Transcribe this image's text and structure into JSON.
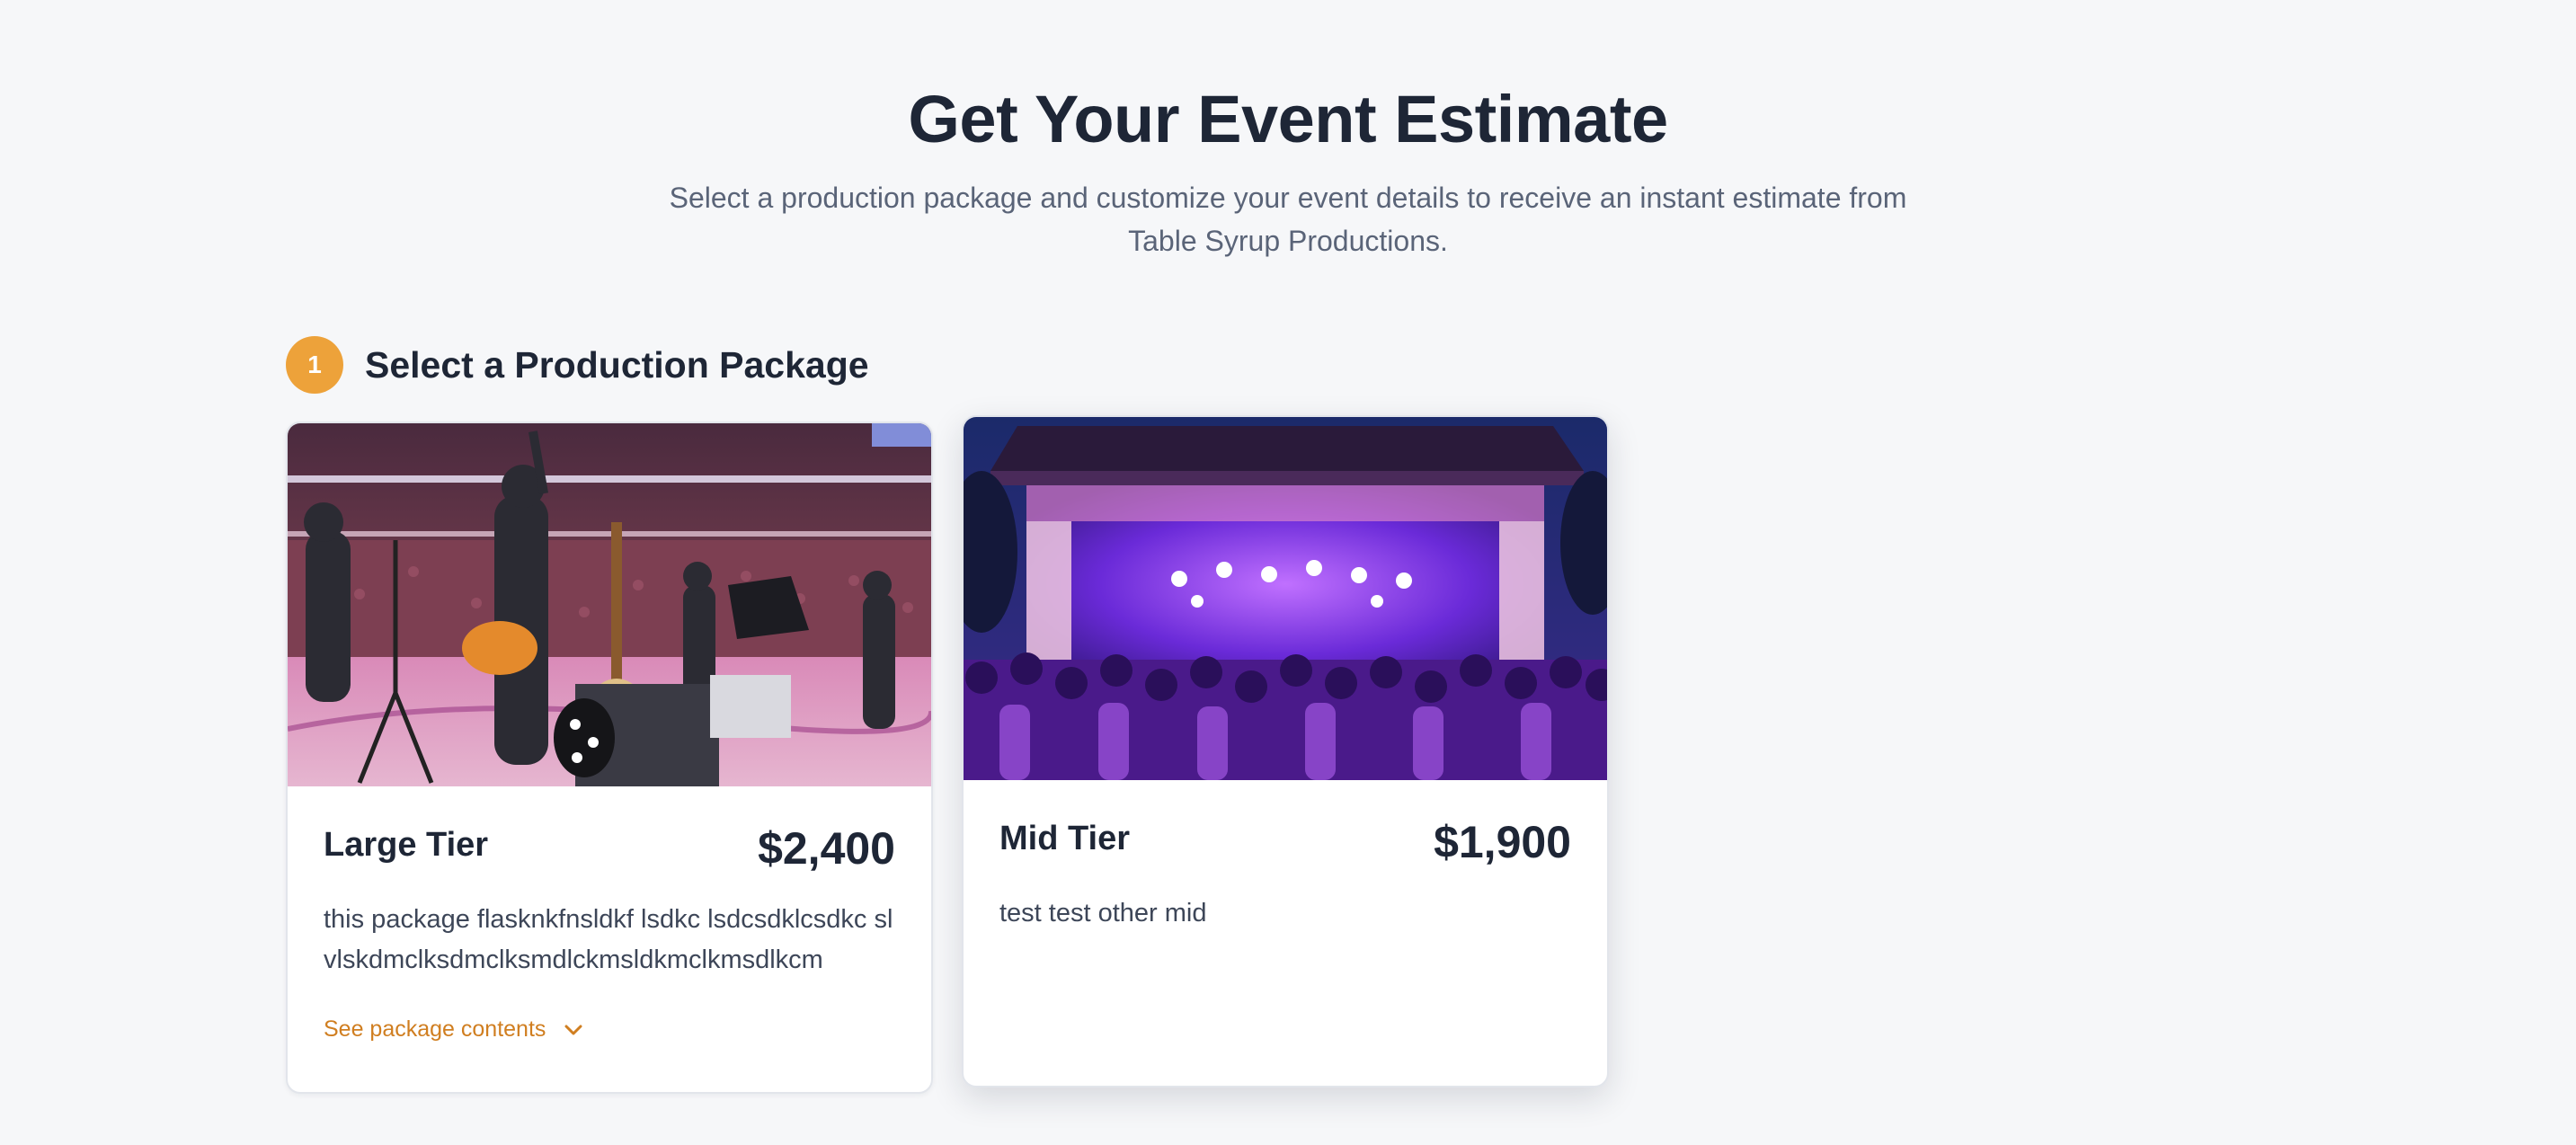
{
  "header": {
    "title": "Get Your Event Estimate",
    "subtitle": "Select a production package and customize your event details to receive an instant estimate from Table Syrup Productions."
  },
  "step": {
    "number": "1",
    "title": "Select a Production Package"
  },
  "packages": [
    {
      "name": "Large Tier",
      "price": "$2,400",
      "description": "this package flasknkfnsldkf lsdkc lsdcsdklcsdkc slvlskdmclksdmclksmdlckmsldkmclkmsdlkcm",
      "toggle_label": "See package contents",
      "toggle_icon": "chevron-down-icon",
      "image_subject": "band-performing-on-arena-court"
    },
    {
      "name": "Mid Tier",
      "price": "$1,900",
      "description": "test test other mid",
      "image_subject": "outdoor-stage-with-purple-lights-and-crowd"
    }
  ],
  "colors": {
    "accent": "#eda23a",
    "link": "#d07e20",
    "text_dark": "#1e2636",
    "text_muted": "#5a6478",
    "background": "#f6f7f9"
  }
}
